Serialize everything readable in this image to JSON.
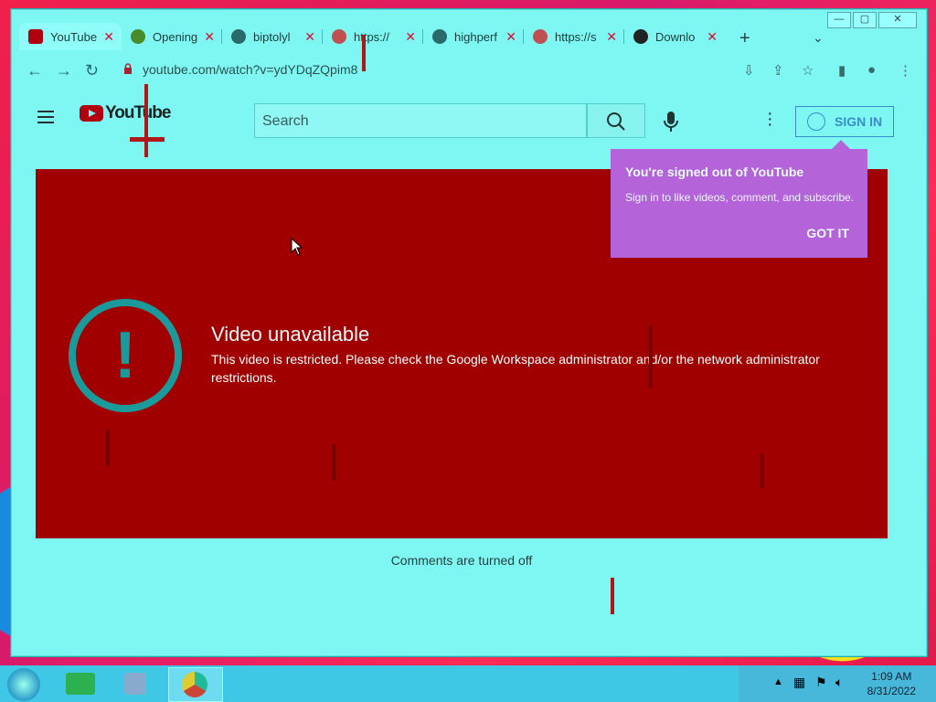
{
  "tabs": [
    {
      "label": "YouTube",
      "icon": "youtube-icon",
      "color": "#b00010"
    },
    {
      "label": "Opening",
      "icon": "reddit-icon",
      "color": "#d04010"
    },
    {
      "label": "biptolyl",
      "icon": "globe-icon",
      "color": "#2a6a6a"
    },
    {
      "label": "https://",
      "icon": "globe-icon",
      "color": "#c03030"
    },
    {
      "label": "highperf",
      "icon": "globe-icon",
      "color": "#2a6a6a"
    },
    {
      "label": "https://s",
      "icon": "globe-icon",
      "color": "#c03030"
    },
    {
      "label": "Downlo",
      "icon": "mega-icon",
      "color": "#222"
    }
  ],
  "window": {
    "minimize": "—",
    "maximize": "▢",
    "close": "✕"
  },
  "addressbar": {
    "url": "youtube.com/watch?v=ydYDqZQpim8"
  },
  "youtube": {
    "logo_text": "YouTube",
    "search_placeholder": "Search",
    "signin_label": "SIGN IN"
  },
  "player": {
    "title": "Video unavailable",
    "message": "This video is restricted. Please check the Google Workspace administrator and/or the network administrator restrictions."
  },
  "comments_text": "Comments are turned off",
  "popup": {
    "title": "You're signed out of YouTube",
    "message": "Sign in to like videos, comment, and subscribe.",
    "button": "GOT IT"
  },
  "clock": {
    "time": "1:09 AM",
    "date": "8/31/2022"
  }
}
